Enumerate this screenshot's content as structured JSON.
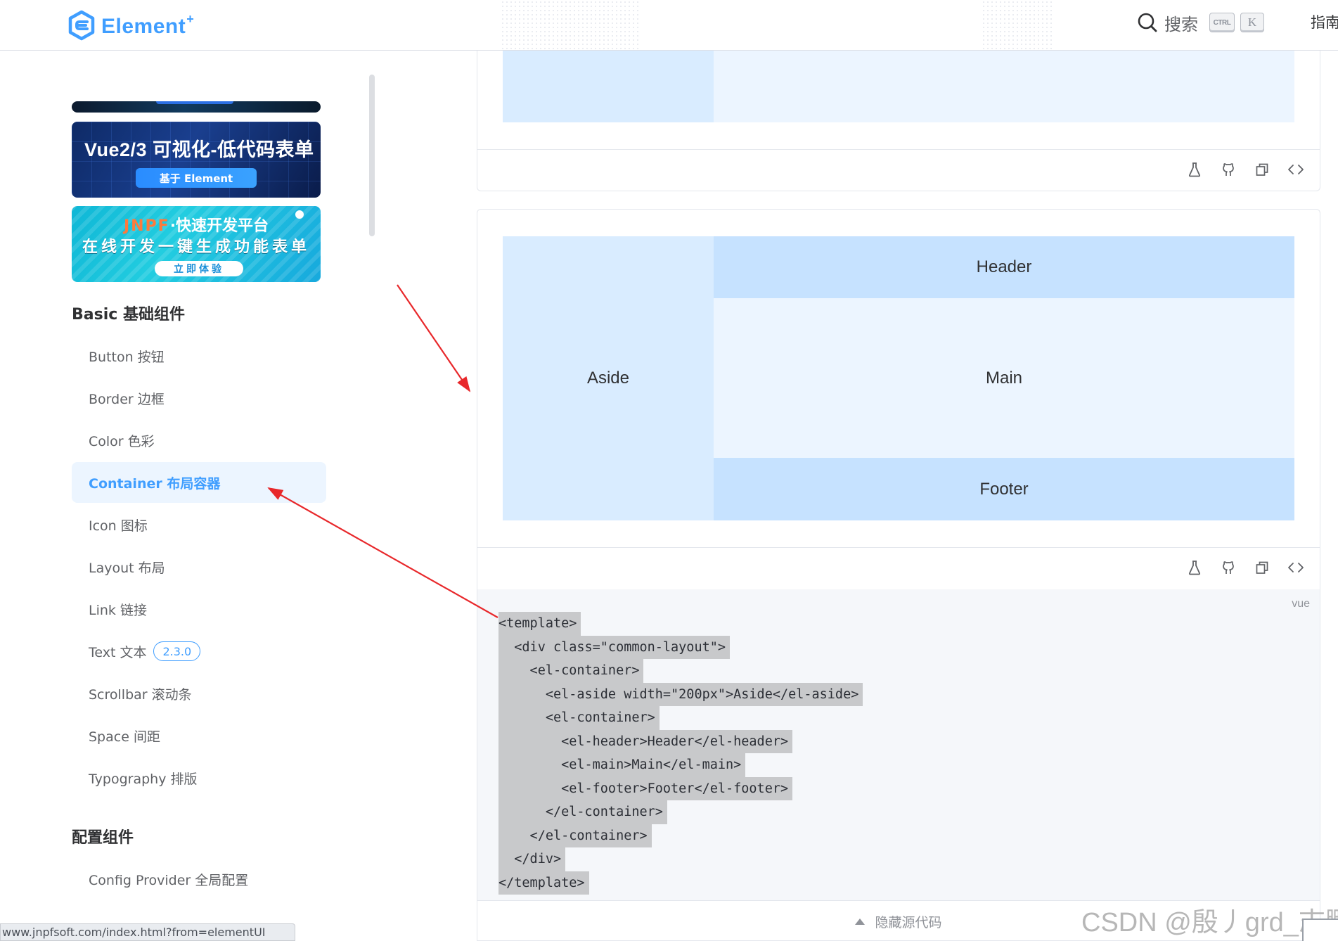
{
  "navbar": {
    "logo_text": "Element",
    "logo_sup": "+",
    "search_label": "搜索",
    "shortcut_ctrl": "CTRL",
    "shortcut_k": "K",
    "guide_label": "指南"
  },
  "sidebar": {
    "banners": [
      {
        "title": "Vue2/3 可视化-低代码表单",
        "button": "基于 Element"
      },
      {
        "brand": "JNPF",
        "subtitle": "·快速开发平台",
        "slogan": "在线开发一键生成功能表单",
        "button": "立即体验"
      }
    ],
    "groups": [
      {
        "title": "Basic 基础组件",
        "items": [
          {
            "label": "Button 按钮"
          },
          {
            "label": "Border 边框"
          },
          {
            "label": "Color 色彩"
          },
          {
            "label": "Container 布局容器",
            "active": true
          },
          {
            "label": "Icon 图标"
          },
          {
            "label": "Layout 布局"
          },
          {
            "label": "Link 链接"
          },
          {
            "label": "Text 文本",
            "badge": "2.3.0"
          },
          {
            "label": "Scrollbar 滚动条"
          },
          {
            "label": "Space 间距"
          },
          {
            "label": "Typography 排版"
          }
        ]
      },
      {
        "title": "配置组件",
        "items": [
          {
            "label": "Config Provider 全局配置"
          }
        ]
      }
    ],
    "status_url": "www.jnpfsoft.com/index.html?from=elementUI"
  },
  "demo": {
    "aside": "Aside",
    "header": "Header",
    "main": "Main",
    "footer": "Footer"
  },
  "code": {
    "language": "vue",
    "lines": [
      "<template>",
      "  <div class=\"common-layout\">",
      "    <el-container>",
      "      <el-aside width=\"200px\">Aside</el-aside>",
      "      <el-container>",
      "        <el-header>Header</el-header>",
      "        <el-main>Main</el-main>",
      "        <el-footer>Footer</el-footer>",
      "      </el-container>",
      "    </el-container>",
      "  </div>",
      "</template>"
    ],
    "toggle_label": "隐藏源代码"
  },
  "actions": [
    "playground-icon",
    "github-icon",
    "copy-icon",
    "code-icon"
  ],
  "colors": {
    "primary": "#409eff",
    "aside_bg": "#d9ecff",
    "header_footer_bg": "#c6e2ff",
    "main_bg": "#ecf5ff",
    "annotation_arrow": "#e8282b"
  },
  "watermark": "CSDN @殷丿grd_志鹏"
}
